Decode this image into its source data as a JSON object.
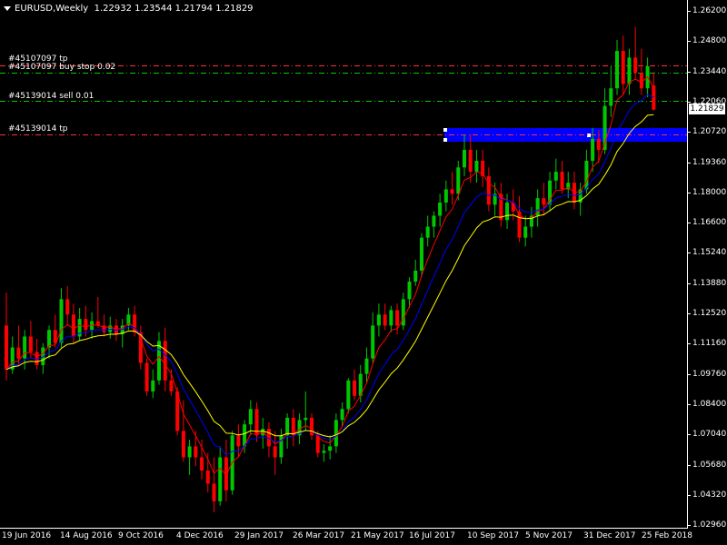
{
  "window": {
    "symbol_timeframe": "EURUSD,Weekly",
    "ohlc": "1.22932 1.23544 1.21794 1.21829"
  },
  "orders": [
    {
      "label": "#45107097 tp",
      "price": 1.2384,
      "color": "#ff3030"
    },
    {
      "label": "#45107097 buy stop 0.02",
      "price": 1.2352,
      "color": "#00d000"
    },
    {
      "label": "#45139014 sell 0.01",
      "price": 1.2222,
      "color": "#00d000"
    },
    {
      "label": "#45139014 tp",
      "price": 1.207,
      "color": "#ff3030"
    }
  ],
  "price_axis": {
    "ticks": [
      "1.26200",
      "1.24800",
      "1.23440",
      "1.22060",
      "1.20720",
      "1.19360",
      "1.18000",
      "1.16600",
      "1.15240",
      "1.13880",
      "1.12520",
      "1.11160",
      "1.09760",
      "1.08400",
      "1.07040",
      "1.05680",
      "1.04320",
      "1.02960"
    ],
    "current_price": "1.21829"
  },
  "time_axis": {
    "labels": [
      "19 Jun 2016",
      "14 Aug 2016",
      "9 Oct 2016",
      "4 Dec 2016",
      "29 Jan 2017",
      "26 Mar 2017",
      "21 May 2017",
      "16 Jul 2017",
      "10 Sep 2017",
      "5 Nov 2017",
      "31 Dec 2017",
      "25 Feb 2018"
    ]
  },
  "colors": {
    "background": "#000000",
    "bull_candle": "#00c800",
    "bear_candle": "#ff0000",
    "ma_fast": "#ff0000",
    "ma_mid": "#0000ff",
    "ma_slow": "#ffff00",
    "zone": "#0000ff"
  },
  "chart_data": {
    "type": "candlestick",
    "symbol": "EURUSD",
    "timeframe": "Weekly",
    "ylim": [
      1.0296,
      1.262
    ],
    "candles": [
      [
        1.12,
        1.135,
        1.095,
        1.1
      ],
      [
        1.1,
        1.115,
        1.098,
        1.11
      ],
      [
        1.11,
        1.12,
        1.102,
        1.105
      ],
      [
        1.105,
        1.118,
        1.1,
        1.115
      ],
      [
        1.115,
        1.122,
        1.105,
        1.108
      ],
      [
        1.108,
        1.114,
        1.1,
        1.102
      ],
      [
        1.102,
        1.112,
        1.098,
        1.11
      ],
      [
        1.11,
        1.12,
        1.105,
        1.118
      ],
      [
        1.118,
        1.125,
        1.11,
        1.112
      ],
      [
        1.112,
        1.137,
        1.11,
        1.132
      ],
      [
        1.132,
        1.138,
        1.12,
        1.125
      ],
      [
        1.125,
        1.13,
        1.112,
        1.115
      ],
      [
        1.115,
        1.128,
        1.113,
        1.123
      ],
      [
        1.123,
        1.129,
        1.115,
        1.118
      ],
      [
        1.118,
        1.126,
        1.114,
        1.122
      ],
      [
        1.122,
        1.133,
        1.119,
        1.12
      ],
      [
        1.12,
        1.125,
        1.115,
        1.117
      ],
      [
        1.117,
        1.124,
        1.114,
        1.12
      ],
      [
        1.12,
        1.123,
        1.113,
        1.116
      ],
      [
        1.116,
        1.123,
        1.11,
        1.12
      ],
      [
        1.12,
        1.128,
        1.118,
        1.125
      ],
      [
        1.125,
        1.129,
        1.115,
        1.117
      ],
      [
        1.117,
        1.12,
        1.1,
        1.103
      ],
      [
        1.103,
        1.105,
        1.088,
        1.09
      ],
      [
        1.09,
        1.1,
        1.087,
        1.095
      ],
      [
        1.095,
        1.117,
        1.093,
        1.113
      ],
      [
        1.113,
        1.119,
        1.09,
        1.095
      ],
      [
        1.095,
        1.1,
        1.088,
        1.09
      ],
      [
        1.09,
        1.092,
        1.07,
        1.072
      ],
      [
        1.072,
        1.086,
        1.058,
        1.06
      ],
      [
        1.06,
        1.068,
        1.052,
        1.065
      ],
      [
        1.065,
        1.072,
        1.056,
        1.06
      ],
      [
        1.06,
        1.068,
        1.05,
        1.054
      ],
      [
        1.054,
        1.062,
        1.044,
        1.048
      ],
      [
        1.048,
        1.06,
        1.035,
        1.04
      ],
      [
        1.04,
        1.065,
        1.038,
        1.06
      ],
      [
        1.06,
        1.068,
        1.04,
        1.045
      ],
      [
        1.045,
        1.072,
        1.043,
        1.07
      ],
      [
        1.07,
        1.075,
        1.06,
        1.065
      ],
      [
        1.065,
        1.077,
        1.062,
        1.075
      ],
      [
        1.075,
        1.086,
        1.07,
        1.082
      ],
      [
        1.082,
        1.085,
        1.067,
        1.07
      ],
      [
        1.07,
        1.078,
        1.064,
        1.073
      ],
      [
        1.073,
        1.076,
        1.06,
        1.065
      ],
      [
        1.065,
        1.072,
        1.052,
        1.06
      ],
      [
        1.06,
        1.073,
        1.057,
        1.07
      ],
      [
        1.07,
        1.08,
        1.064,
        1.078
      ],
      [
        1.078,
        1.082,
        1.065,
        1.07
      ],
      [
        1.07,
        1.08,
        1.066,
        1.077
      ],
      [
        1.077,
        1.09,
        1.072,
        1.078
      ],
      [
        1.078,
        1.08,
        1.068,
        1.07
      ],
      [
        1.07,
        1.072,
        1.06,
        1.062
      ],
      [
        1.062,
        1.066,
        1.058,
        1.063
      ],
      [
        1.063,
        1.07,
        1.059,
        1.065
      ],
      [
        1.065,
        1.08,
        1.062,
        1.077
      ],
      [
        1.077,
        1.085,
        1.074,
        1.082
      ],
      [
        1.082,
        1.096,
        1.08,
        1.095
      ],
      [
        1.095,
        1.1,
        1.086,
        1.088
      ],
      [
        1.088,
        1.102,
        1.085,
        1.098
      ],
      [
        1.098,
        1.11,
        1.094,
        1.105
      ],
      [
        1.105,
        1.126,
        1.103,
        1.12
      ],
      [
        1.12,
        1.13,
        1.115,
        1.125
      ],
      [
        1.125,
        1.13,
        1.118,
        1.12
      ],
      [
        1.12,
        1.129,
        1.117,
        1.127
      ],
      [
        1.127,
        1.13,
        1.116,
        1.12
      ],
      [
        1.12,
        1.135,
        1.118,
        1.132
      ],
      [
        1.132,
        1.142,
        1.128,
        1.14
      ],
      [
        1.14,
        1.15,
        1.138,
        1.145
      ],
      [
        1.145,
        1.162,
        1.142,
        1.16
      ],
      [
        1.16,
        1.17,
        1.156,
        1.165
      ],
      [
        1.165,
        1.172,
        1.16,
        1.17
      ],
      [
        1.17,
        1.18,
        1.165,
        1.176
      ],
      [
        1.176,
        1.186,
        1.172,
        1.182
      ],
      [
        1.182,
        1.19,
        1.175,
        1.18
      ],
      [
        1.18,
        1.195,
        1.177,
        1.192
      ],
      [
        1.192,
        1.207,
        1.188,
        1.2
      ],
      [
        1.2,
        1.207,
        1.185,
        1.19
      ],
      [
        1.19,
        1.2,
        1.185,
        1.195
      ],
      [
        1.195,
        1.2,
        1.183,
        1.188
      ],
      [
        1.188,
        1.192,
        1.172,
        1.175
      ],
      [
        1.175,
        1.185,
        1.17,
        1.18
      ],
      [
        1.18,
        1.185,
        1.165,
        1.168
      ],
      [
        1.168,
        1.18,
        1.164,
        1.176
      ],
      [
        1.176,
        1.182,
        1.168,
        1.172
      ],
      [
        1.172,
        1.179,
        1.158,
        1.16
      ],
      [
        1.16,
        1.17,
        1.156,
        1.165
      ],
      [
        1.165,
        1.174,
        1.16,
        1.17
      ],
      [
        1.17,
        1.182,
        1.165,
        1.178
      ],
      [
        1.178,
        1.185,
        1.17,
        1.175
      ],
      [
        1.175,
        1.19,
        1.172,
        1.186
      ],
      [
        1.186,
        1.196,
        1.182,
        1.19
      ],
      [
        1.19,
        1.195,
        1.18,
        1.182
      ],
      [
        1.182,
        1.19,
        1.178,
        1.185
      ],
      [
        1.185,
        1.19,
        1.173,
        1.176
      ],
      [
        1.176,
        1.185,
        1.17,
        1.182
      ],
      [
        1.182,
        1.2,
        1.18,
        1.195
      ],
      [
        1.195,
        1.21,
        1.19,
        1.205
      ],
      [
        1.205,
        1.209,
        1.194,
        1.2
      ],
      [
        1.2,
        1.228,
        1.198,
        1.22
      ],
      [
        1.22,
        1.238,
        1.215,
        1.228
      ],
      [
        1.228,
        1.25,
        1.225,
        1.245
      ],
      [
        1.245,
        1.252,
        1.225,
        1.23
      ],
      [
        1.23,
        1.246,
        1.225,
        1.242
      ],
      [
        1.242,
        1.256,
        1.232,
        1.235
      ],
      [
        1.235,
        1.246,
        1.225,
        1.228
      ],
      [
        1.228,
        1.242,
        1.224,
        1.238
      ],
      [
        1.2293,
        1.2354,
        1.2179,
        1.2183
      ]
    ]
  }
}
